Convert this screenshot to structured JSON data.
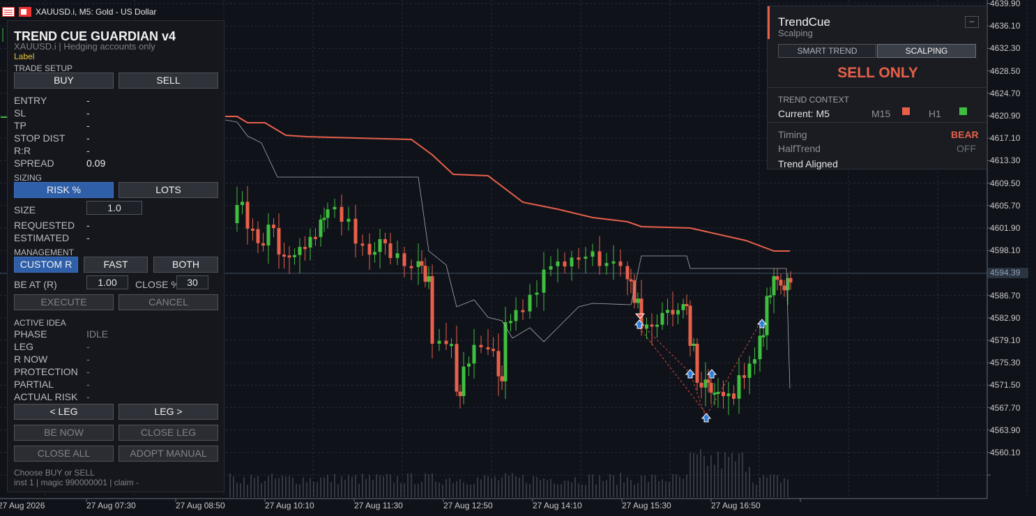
{
  "window": {
    "title": "XAUUSD.i, M5:  Gold - US Dollar"
  },
  "price_axis": {
    "labels": [
      "4639.90",
      "4636.10",
      "4632.30",
      "4628.50",
      "4624.70",
      "4620.90",
      "4617.10",
      "4613.30",
      "4609.50",
      "4605.70",
      "4601.90",
      "4598.10",
      "4594.39",
      "4590.50",
      "4586.70",
      "4582.90",
      "4579.10",
      "4575.30",
      "4571.50",
      "4567.70",
      "4563.90",
      "4560.10"
    ],
    "current_price": "4594.39"
  },
  "time_axis": {
    "labels": [
      "27 Aug 2026",
      "27 Aug 07:30",
      "27 Aug 08:50",
      "27 Aug 10:10",
      "27 Aug 11:30",
      "27 Aug 12:50",
      "27 Aug 14:10",
      "27 Aug 15:30",
      "27 Aug 16:50"
    ]
  },
  "colors": {
    "bull": "#3fbf3f",
    "bear": "#e8604a",
    "background": "#10121a",
    "grid": "#262b36",
    "upper_line": "#e8604a",
    "lower_line": "#a9abb0"
  },
  "guardian": {
    "title": "TREND CUE GUARDIAN v4",
    "subtitle": "XAUUSD.i  |  Hedging accounts only",
    "label": "Label",
    "trade_setup": {
      "heading": "TRADE SETUP",
      "buy": "BUY",
      "sell": "SELL",
      "rows": [
        {
          "label": "ENTRY",
          "value": "-"
        },
        {
          "label": "SL",
          "value": "-"
        },
        {
          "label": "TP",
          "value": "-"
        },
        {
          "label": "STOP DIST",
          "value": "-"
        },
        {
          "label": "R:R",
          "value": "-"
        },
        {
          "label": "SPREAD",
          "value": "0.09"
        }
      ]
    },
    "sizing": {
      "heading": "SIZING",
      "risk_pct": "RISK %",
      "lots": "LOTS",
      "size_label": "SIZE",
      "size_value": "1.0",
      "requested_label": "REQUESTED",
      "requested_value": "-",
      "estimated_label": "ESTIMATED",
      "estimated_value": "-"
    },
    "management": {
      "heading": "MANAGEMENT",
      "custom_r": "CUSTOM R",
      "fast": "FAST",
      "both": "BOTH",
      "be_at_label": "BE AT (R)",
      "be_at_value": "1.00",
      "close_pct_label": "CLOSE %",
      "close_pct_value": "30",
      "execute": "EXECUTE",
      "cancel": "CANCEL"
    },
    "active_idea": {
      "heading": "ACTIVE IDEA",
      "rows": [
        {
          "label": "PHASE",
          "value": "IDLE"
        },
        {
          "label": "LEG",
          "value": "-"
        },
        {
          "label": "R NOW",
          "value": "-"
        },
        {
          "label": "PROTECTION",
          "value": "-"
        },
        {
          "label": "PARTIAL",
          "value": "-"
        },
        {
          "label": "ACTUAL RISK",
          "value": "-"
        }
      ],
      "prev_leg": "< LEG",
      "next_leg": "LEG >",
      "be_now": "BE NOW",
      "close_leg": "CLOSE LEG",
      "close_all": "CLOSE ALL",
      "adopt_manual": "ADOPT MANUAL"
    },
    "footer": {
      "hint": "Choose BUY or SELL",
      "info": "inst 1 | magic 990000001 | claim -"
    }
  },
  "trendcue": {
    "title": "TrendCue",
    "subtitle": "Scalping",
    "minimize": "–",
    "tabs": [
      "SMART TREND",
      "SCALPING"
    ],
    "active_tab": "SCALPING",
    "signal": "SELL ONLY",
    "trend_context_heading": "TREND CONTEXT",
    "current": "Current: M5",
    "m15_label": "M15",
    "m15_color": "#e8604a",
    "h1_label": "H1",
    "h1_color": "#3fbf3f",
    "timing_label": "Timing",
    "timing_value": "BEAR",
    "halftrend_label": "HalfTrend",
    "halftrend_value": "OFF",
    "trend_aligned": "Trend Aligned"
  }
}
